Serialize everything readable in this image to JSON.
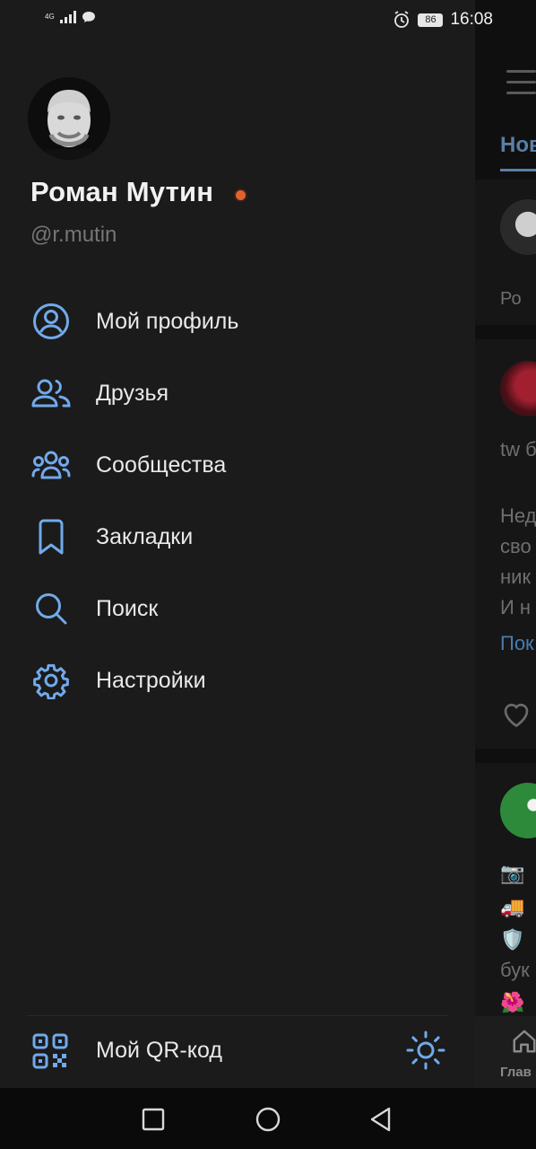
{
  "status_bar": {
    "network": "4G",
    "battery": "86",
    "time": "16:08"
  },
  "profile": {
    "name": "Роман Мутин",
    "handle": "@r.mutin"
  },
  "menu": [
    {
      "label": "Мой профиль",
      "icon": "user-circle-icon"
    },
    {
      "label": "Друзья",
      "icon": "friends-icon"
    },
    {
      "label": "Сообщества",
      "icon": "communities-icon"
    },
    {
      "label": "Закладки",
      "icon": "bookmark-icon"
    },
    {
      "label": "Поиск",
      "icon": "search-icon"
    },
    {
      "label": "Настройки",
      "icon": "gear-icon"
    }
  ],
  "footer": {
    "qr_label": "Мой QR-код",
    "qr_icon": "qr-code-icon",
    "theme_icon": "sun-icon"
  },
  "background_feed": {
    "tab": "Нов",
    "story_label": "Ро",
    "post1_text_1": "tw б",
    "post1_lines": [
      "Нед",
      "сво",
      "ник",
      "И н"
    ],
    "post1_more": "Пок",
    "post2_lines": [
      "📷 ",
      "🚚 ",
      "🛡️ ",
      "бук",
      "🌺 "
    ],
    "bottom_nav_label": "Глав"
  },
  "colors": {
    "accent": "#71aaeb",
    "background": "#1b1b1b",
    "online": "#e4612d"
  }
}
